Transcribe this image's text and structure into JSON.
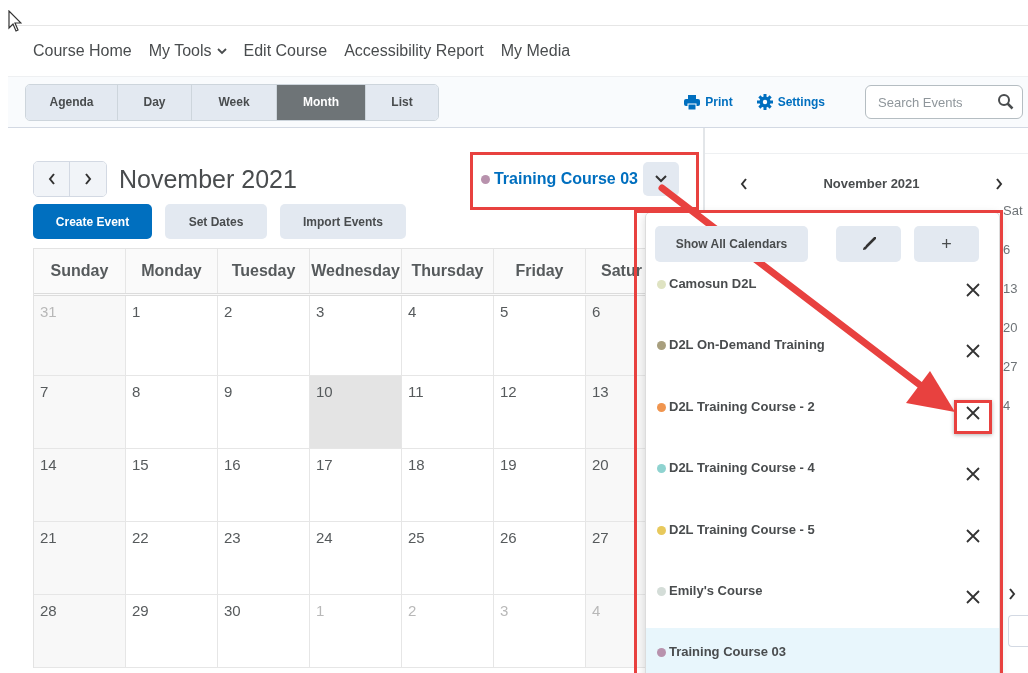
{
  "top_nav": [
    {
      "label": "Course Home",
      "has_menu": false
    },
    {
      "label": "My Tools",
      "has_menu": true
    },
    {
      "label": "Edit Course",
      "has_menu": false
    },
    {
      "label": "Accessibility Report",
      "has_menu": false
    },
    {
      "label": "My Media",
      "has_menu": false
    }
  ],
  "view_tabs": [
    {
      "label": "Agenda",
      "selected": false
    },
    {
      "label": "Day",
      "selected": false
    },
    {
      "label": "Week",
      "selected": false
    },
    {
      "label": "Month",
      "selected": true
    },
    {
      "label": "List",
      "selected": false
    }
  ],
  "toolbar_actions": [
    {
      "label": "Print",
      "kind": "print"
    },
    {
      "label": "Settings",
      "kind": "settings"
    }
  ],
  "search": {
    "placeholder": "Search Events"
  },
  "month_title": "November 2021",
  "action_buttons": [
    {
      "label": "Create Event",
      "primary": true
    },
    {
      "label": "Set Dates",
      "primary": false
    },
    {
      "label": "Import Events",
      "primary": false
    }
  ],
  "calendar_selector": {
    "label": "Training Course 03",
    "color": "#b892ad"
  },
  "calendar_grid": {
    "columns": [
      "Sunday",
      "Monday",
      "Tuesday",
      "Wednesday",
      "Thursday",
      "Friday",
      "Satur"
    ],
    "rows": [
      [
        {
          "day": "31",
          "other_month": true,
          "today": false
        },
        {
          "day": "1",
          "other_month": false,
          "today": false
        },
        {
          "day": "2",
          "other_month": false,
          "today": false
        },
        {
          "day": "3",
          "other_month": false,
          "today": false
        },
        {
          "day": "4",
          "other_month": false,
          "today": false
        },
        {
          "day": "5",
          "other_month": false,
          "today": false
        },
        {
          "day": "6",
          "other_month": false,
          "today": false
        }
      ],
      [
        {
          "day": "7",
          "other_month": false,
          "today": false
        },
        {
          "day": "8",
          "other_month": false,
          "today": false
        },
        {
          "day": "9",
          "other_month": false,
          "today": false
        },
        {
          "day": "10",
          "other_month": false,
          "today": true
        },
        {
          "day": "11",
          "other_month": false,
          "today": false
        },
        {
          "day": "12",
          "other_month": false,
          "today": false
        },
        {
          "day": "13",
          "other_month": false,
          "today": false
        }
      ],
      [
        {
          "day": "14",
          "other_month": false,
          "today": false
        },
        {
          "day": "15",
          "other_month": false,
          "today": false
        },
        {
          "day": "16",
          "other_month": false,
          "today": false
        },
        {
          "day": "17",
          "other_month": false,
          "today": false
        },
        {
          "day": "18",
          "other_month": false,
          "today": false
        },
        {
          "day": "19",
          "other_month": false,
          "today": false
        },
        {
          "day": "20",
          "other_month": false,
          "today": false
        }
      ],
      [
        {
          "day": "21",
          "other_month": false,
          "today": false
        },
        {
          "day": "22",
          "other_month": false,
          "today": false
        },
        {
          "day": "23",
          "other_month": false,
          "today": false
        },
        {
          "day": "24",
          "other_month": false,
          "today": false
        },
        {
          "day": "25",
          "other_month": false,
          "today": false
        },
        {
          "day": "26",
          "other_month": false,
          "today": false
        },
        {
          "day": "27",
          "other_month": false,
          "today": false
        }
      ],
      [
        {
          "day": "28",
          "other_month": false,
          "today": false
        },
        {
          "day": "29",
          "other_month": false,
          "today": false
        },
        {
          "day": "30",
          "other_month": false,
          "today": false
        },
        {
          "day": "1",
          "other_month": true,
          "today": false
        },
        {
          "day": "2",
          "other_month": true,
          "today": false
        },
        {
          "day": "3",
          "other_month": true,
          "today": false
        },
        {
          "day": "4",
          "other_month": true,
          "today": false
        }
      ]
    ]
  },
  "mini_calendar": {
    "title": "November 2021",
    "saturday_column": [
      "Sat",
      "6",
      "13",
      "20",
      "27",
      "4"
    ]
  },
  "calendar_menu": {
    "buttons": [
      {
        "kind": "text",
        "label": "Show All Calendars"
      },
      {
        "kind": "brush"
      },
      {
        "kind": "text",
        "label": "+"
      }
    ],
    "items": [
      {
        "name": "Camosun D2L",
        "color": "#dfe3c2",
        "selected": false,
        "removable": true
      },
      {
        "name": "D2L On-Demand Training",
        "color": "#a89f7e",
        "selected": false,
        "removable": true
      },
      {
        "name": "D2L Training Course - 2",
        "color": "#f0954f",
        "selected": false,
        "removable": true
      },
      {
        "name": "D2L Training Course - 4",
        "color": "#8fd3d0",
        "selected": false,
        "removable": true
      },
      {
        "name": "D2L Training Course - 5",
        "color": "#e8c95c",
        "selected": false,
        "removable": true
      },
      {
        "name": "Emily's Course",
        "color": "#d4ddd8",
        "selected": false,
        "removable": true
      },
      {
        "name": "Training Course 03",
        "color": "#b892ad",
        "selected": true,
        "removable": false
      }
    ]
  }
}
